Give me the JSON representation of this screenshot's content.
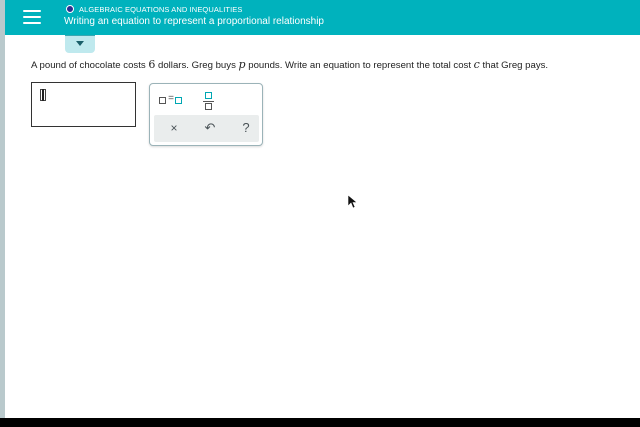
{
  "header": {
    "menu_icon": "hamburger-menu-icon",
    "topic": "ALGEBRAIC EQUATIONS AND INEQUALITIES",
    "lesson_title": "Writing an equation to represent a proportional relationship"
  },
  "question": {
    "part1": "A pound of chocolate costs ",
    "num": "6",
    "part2": " dollars. Greg buys ",
    "var_p": "p",
    "part3": " pounds. Write an equation to represent the total cost ",
    "var_c": "c",
    "part4": " that Greg pays."
  },
  "keypad": {
    "equals_sign": "=",
    "clear_label": "×",
    "undo_label": "↶",
    "help_label": "?"
  },
  "colors": {
    "header": "#00b2bd",
    "accent": "#00a7b3",
    "topic_dot": "#2b2f8f"
  }
}
